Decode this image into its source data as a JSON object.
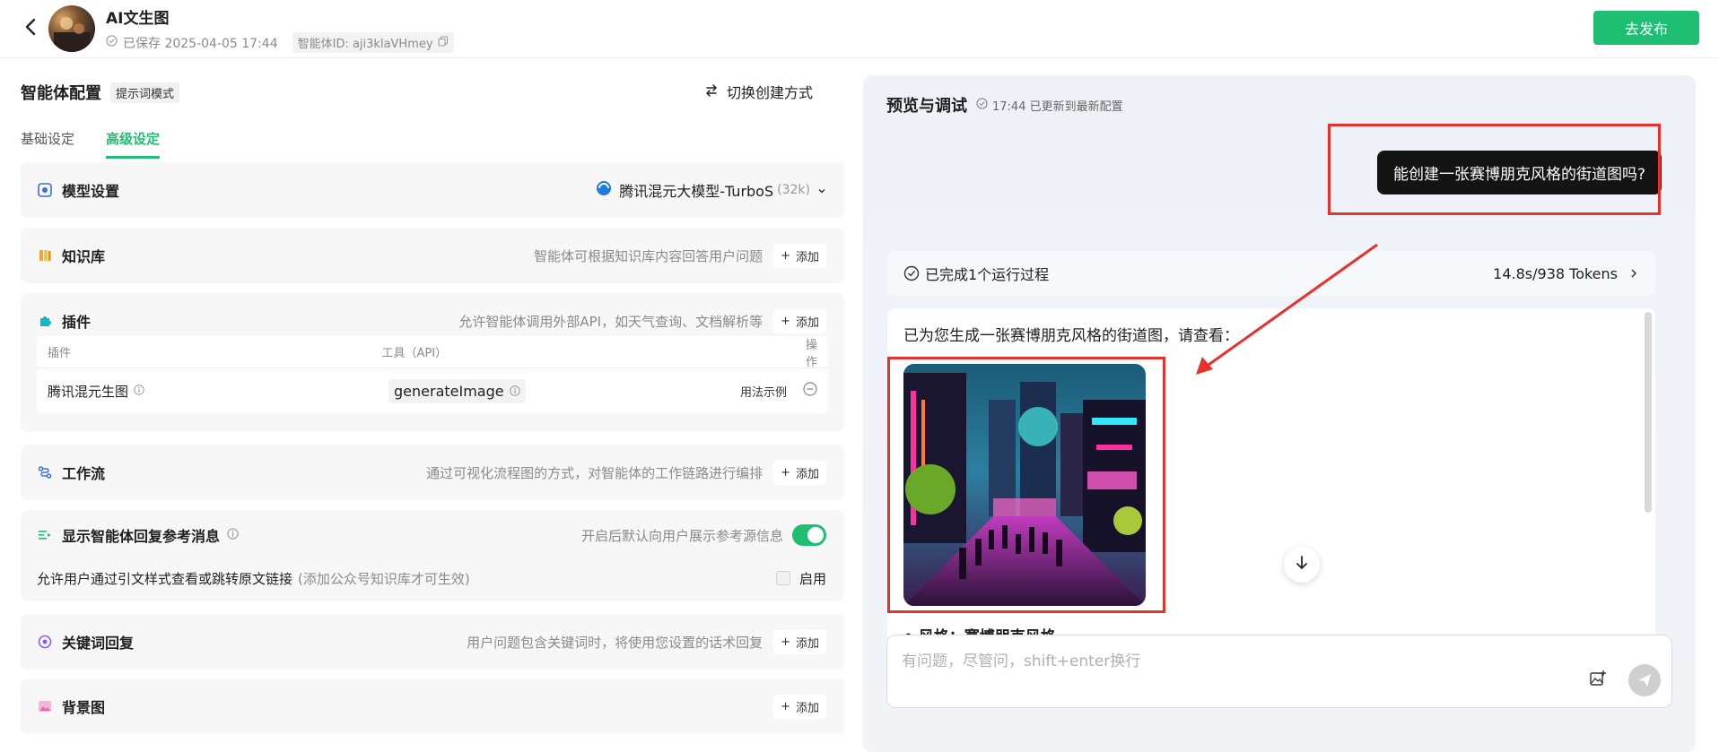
{
  "header": {
    "title": "AI文生图",
    "saved_text": "已保存 2025-04-05 17:44",
    "agent_id": "智能体ID: aji3klaVHmey",
    "publish_label": "去发布"
  },
  "left": {
    "title": "智能体配置",
    "mode_badge": "提示词模式",
    "switch_mode": "切换创建方式",
    "tabs": [
      {
        "label": "基础设定",
        "active": false
      },
      {
        "label": "高级设定",
        "active": true
      }
    ],
    "model": {
      "title": "模型设置",
      "name": "腾讯混元大模型-TurboS",
      "ctx": "(32k)"
    },
    "knowledge": {
      "title": "知识库",
      "desc": "智能体可根据知识库内容回答用户问题",
      "add": "添加"
    },
    "plugins": {
      "title": "插件",
      "desc": "允许智能体调用外部API，如天气查询、文档解析等",
      "add": "添加",
      "columns": [
        "插件",
        "工具（API）",
        "操作"
      ],
      "rows": [
        {
          "name": "腾讯混元生图",
          "api": "generateImage",
          "action": "用法示例"
        }
      ]
    },
    "workflow": {
      "title": "工作流",
      "desc": "通过可视化流程图的方式，对智能体的工作链路进行编排",
      "add": "添加"
    },
    "reference": {
      "title": "显示智能体回复参考消息",
      "desc": "开启后默认向用户展示参考源信息",
      "enabled": true,
      "sub_text": "允许用户通过引文样式查看或跳转原文链接",
      "sub_hint": "(添加公众号知识库才可生效)",
      "checkbox_label": "启用"
    },
    "keyword": {
      "title": "关键词回复",
      "desc": "用户问题包含关键词时，将使用您设置的话术回复",
      "add": "添加"
    },
    "background": {
      "title": "背景图",
      "add": "添加"
    }
  },
  "preview": {
    "title": "预览与调试",
    "status": "17:44 已更新到最新配置",
    "user_message": "能创建一张赛博朋克风格的街道图吗?",
    "run_status": "已完成1个运行过程",
    "run_stats": "14.8s/938 Tokens",
    "reply_text": "已为您生成一张赛博朋克风格的街道图，请查看：",
    "bullet_text": "• 风格：赛博朋克风格",
    "input_placeholder": "有问题，尽管问，shift+enter换行"
  },
  "colors": {
    "accent": "#1fbf73",
    "highlight": "#e5322d",
    "user_bubble": "#141414"
  }
}
